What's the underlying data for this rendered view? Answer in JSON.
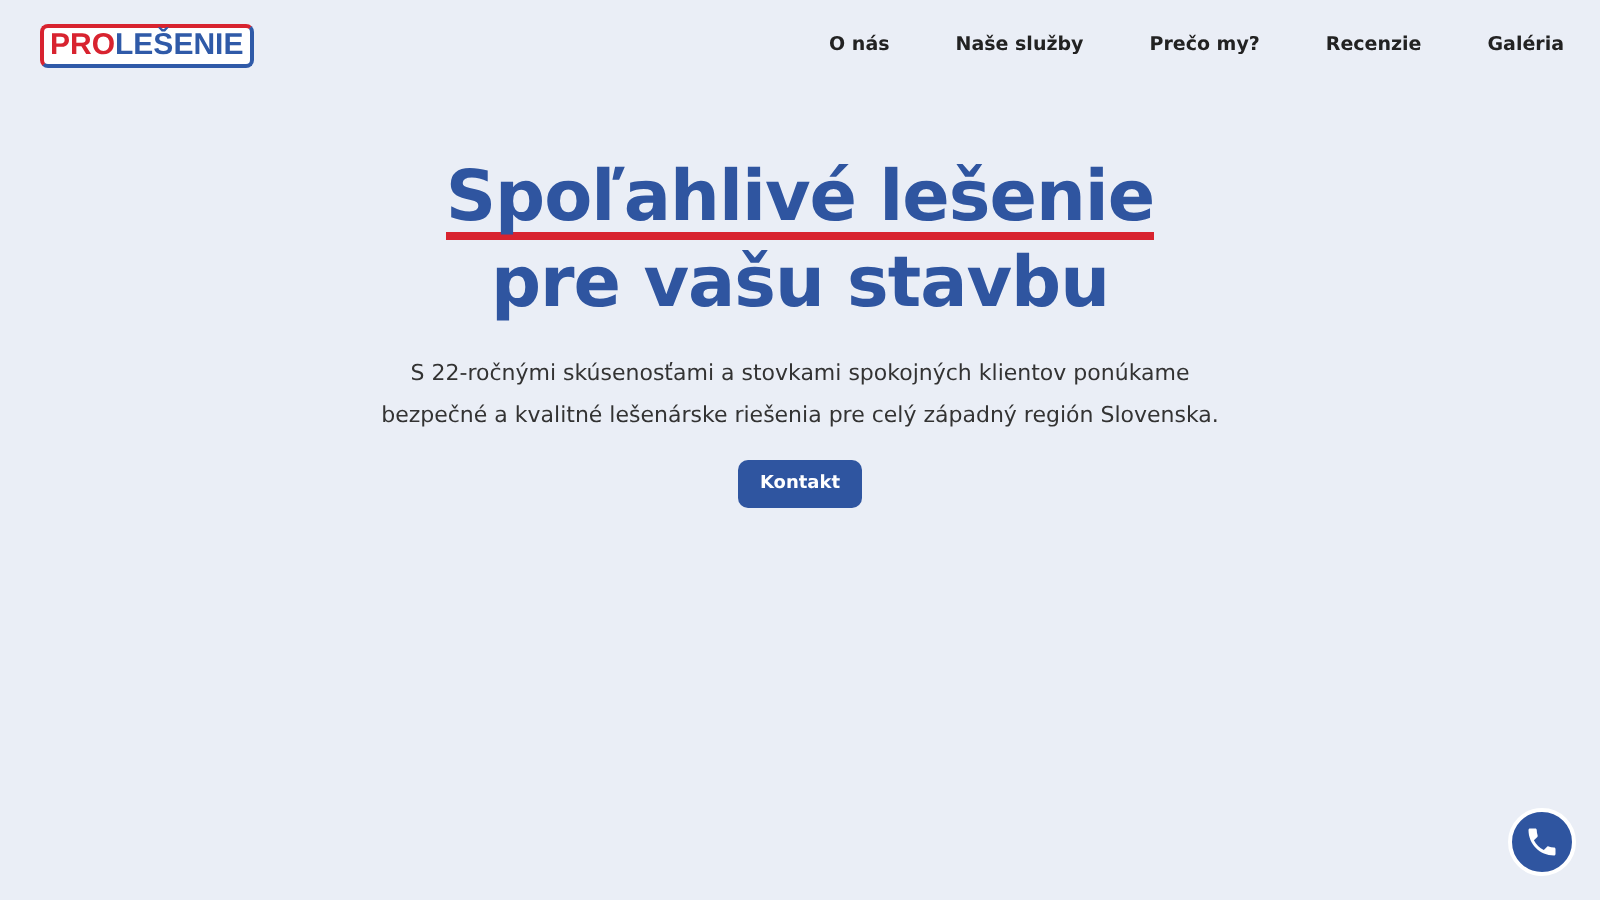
{
  "logo": {
    "part_1": "PRO",
    "part_2": "LEŠENIE"
  },
  "nav": [
    "O nás",
    "Naše služby",
    "Prečo my?",
    "Recenzie",
    "Galéria"
  ],
  "hero": {
    "title_line_1": "Spoľahlivé lešenie",
    "title_line_2": "pre vašu stavbu",
    "text": "S 22-ročnými skúsenosťami a stovkami spokojných klientov ponúkame bezpečné a kvalitné lešenárske riešenia pre celý západný región Slovenska.",
    "button": "Kontakt"
  }
}
